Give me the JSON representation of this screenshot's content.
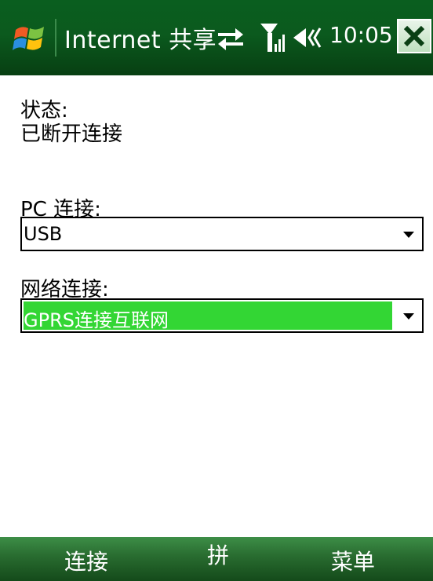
{
  "titlebar": {
    "title": "Internet 共享",
    "time": "10:05",
    "icons": [
      "windows-start-icon",
      "sync-icon",
      "signal-icon",
      "volume-icon",
      "close-icon"
    ]
  },
  "content": {
    "status_label": "状态:",
    "status_value": "已断开连接",
    "pc_connection_label": "PC 连接:",
    "pc_connection_value": "USB",
    "network_connection_label": "网络连接:",
    "network_connection_value": "GPRS连接互联网"
  },
  "softkeys": {
    "left": "连接",
    "middle": "拼",
    "right": "菜单"
  },
  "colors": {
    "titlebar": "#0a5e1f",
    "softbar": "#2a6e31",
    "selection": "#33d634"
  }
}
